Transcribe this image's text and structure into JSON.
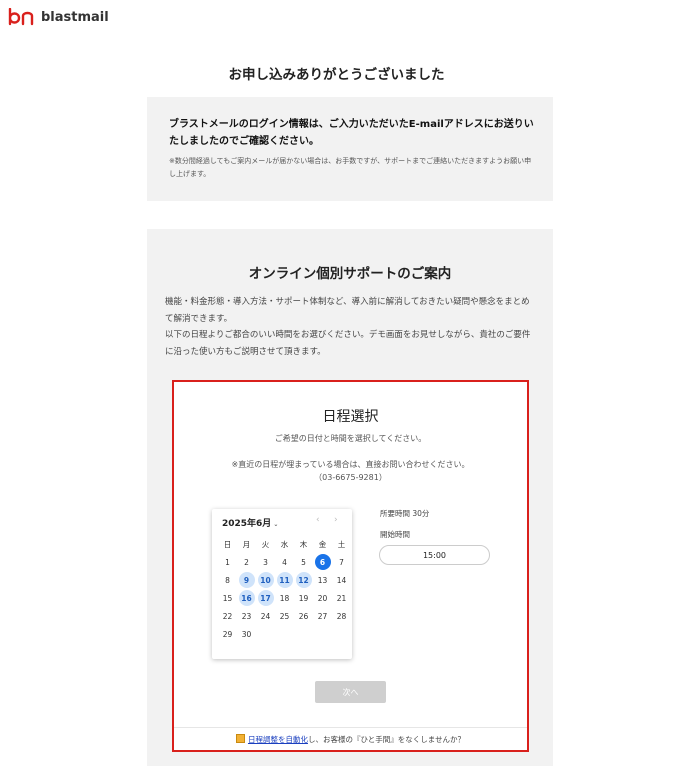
{
  "brand": {
    "name": "blastmail",
    "mark_color": "#d9201c"
  },
  "thanks": {
    "title": "お申し込みありがとうございました",
    "main": "ブラストメールのログイン情報は、ご入力いただいたE-mailアドレスにお送りいたしましたのでご確認ください。",
    "note": "※数分間経過してもご案内メールが届かない場合は、お手数ですが、サポートまでご連絡いただきますようお願い申し上げます。"
  },
  "support": {
    "title": "オンライン個別サポートのご案内",
    "desc1": "機能・料金形態・導入方法・サポート体制など、導入前に解消しておきたい疑問や懸念をまとめて解消できます。",
    "desc2": "以下の日程よりご都合のいい時間をお選びください。デモ画面をお見せしながら、貴社のご要件に沿った使い方もご説明させて頂きます。"
  },
  "scheduler": {
    "title": "日程選択",
    "subtitle": "ご希望の日付と時間を選択してください。",
    "note_line1": "※直近の日程が埋まっている場合は、直接お問い合わせください。",
    "note_line2": "（03-6675-9281）",
    "month": "2025年6月",
    "caret": "⌄",
    "prev": "‹",
    "next": "›",
    "weekdays": [
      "日",
      "月",
      "火",
      "水",
      "木",
      "金",
      "土"
    ],
    "today": 6,
    "available": [
      9,
      10,
      11,
      12,
      16,
      17
    ],
    "days_in_month": 30,
    "first_weekday": 0,
    "duration": "所要時間 30分",
    "start_label": "開始時間",
    "time_option": "15:00",
    "next_button": "次へ",
    "footer_link": "日程調整を自動化",
    "footer_rest": "し、お客様の『ひと手間』をなくしませんか？",
    "accent_color": "#1a73e8",
    "available_bg": "#cfe3fa",
    "highlight_border": "#d9201c"
  }
}
